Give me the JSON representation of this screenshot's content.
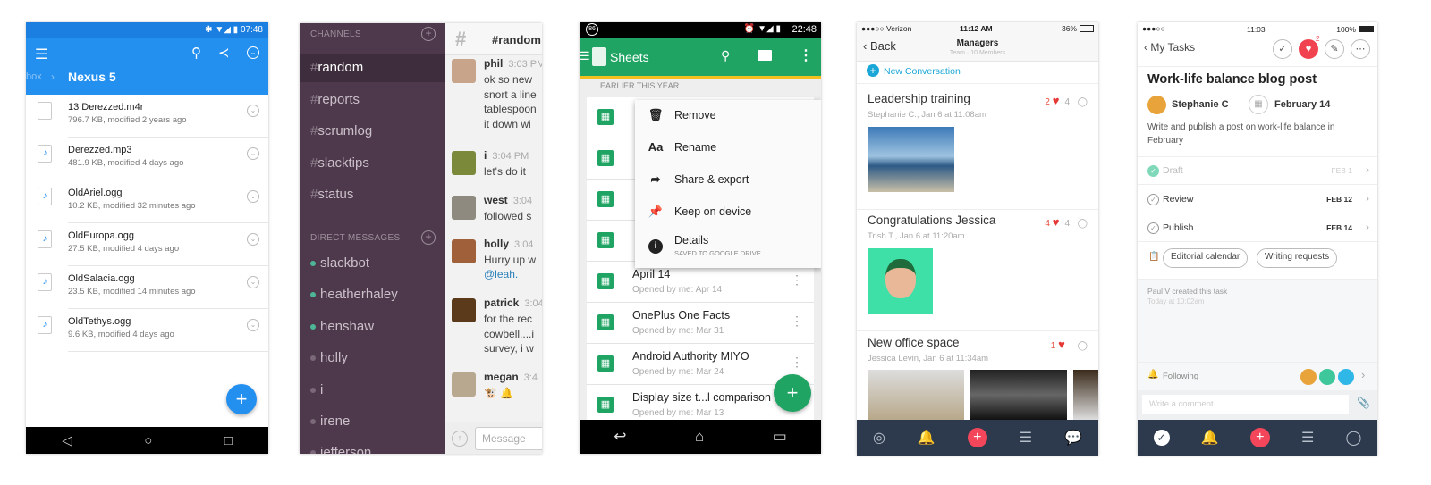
{
  "dropbox": {
    "status_time": "07:48",
    "breadcrumb_parent": "box",
    "breadcrumb_current": "Nexus 5",
    "accent": "#2390f0",
    "files": [
      {
        "name": "13 Derezzed.m4r",
        "meta": "796.7 KB, modified 2 years ago",
        "icon": "file-icon"
      },
      {
        "name": "Derezzed.mp3",
        "meta": "481.9 KB, modified 4 days ago",
        "icon": "music-file-icon"
      },
      {
        "name": "OldAriel.ogg",
        "meta": "10.2 KB, modified 32 minutes ago",
        "icon": "music-file-icon"
      },
      {
        "name": "OldEuropa.ogg",
        "meta": "27.5 KB, modified 4 days ago",
        "icon": "music-file-icon"
      },
      {
        "name": "OldSalacia.ogg",
        "meta": "23.5 KB, modified 14 minutes ago",
        "icon": "music-file-icon"
      },
      {
        "name": "OldTethys.ogg",
        "meta": "9.6 KB, modified 4 days ago",
        "icon": "music-file-icon"
      }
    ]
  },
  "slack": {
    "channels_header": "CHANNELS",
    "dm_header": "DIRECT MESSAGES",
    "hash": "#",
    "channels": [
      "random",
      "reports",
      "scrumlog",
      "slacktips",
      "status"
    ],
    "dms": [
      {
        "name": "slackbot",
        "online": true
      },
      {
        "name": "heatherhaley",
        "online": true
      },
      {
        "name": "henshaw",
        "online": true
      },
      {
        "name": "holly",
        "online": false
      },
      {
        "name": "i",
        "online": false
      },
      {
        "name": "irene",
        "online": false
      },
      {
        "name": "jefferson",
        "online": false
      }
    ],
    "channel_title": "#random",
    "message_placeholder": "Message",
    "messages": [
      {
        "user": "phil",
        "time": "3:03 PM",
        "text": "ok so new\nsnort a line\ntablespoon\nit down wi"
      },
      {
        "user": "i",
        "time": "3:04 PM",
        "text": "let's do it"
      },
      {
        "user": "west",
        "time": "3:04",
        "text": "followed s"
      },
      {
        "user": "holly",
        "time": "3:04",
        "text": "Hurry up w",
        "mention": "@leah."
      },
      {
        "user": "patrick",
        "time": "3:04",
        "text": "for the rec\ncowbell....i\nsurvey, i w"
      },
      {
        "user": "megan",
        "time": "3:4",
        "text": "🐮 🔔"
      }
    ]
  },
  "sheets": {
    "status_time": "22:48",
    "status_badge": "86",
    "app_title": "Sheets",
    "section": "EARLIER THIS YEAR",
    "accent": "#1fa463",
    "menu": [
      {
        "label": "Remove",
        "icon": "trash-icon"
      },
      {
        "label": "Rename",
        "icon": "text-icon"
      },
      {
        "label": "Share & export",
        "icon": "share-icon"
      },
      {
        "label": "Keep on device",
        "icon": "pin-icon"
      },
      {
        "label": "Details",
        "sub": "SAVED TO GOOGLE DRIVE",
        "icon": "info-icon"
      }
    ],
    "files": [
      {
        "name": "April 14",
        "meta": "Opened by me: Apr 14"
      },
      {
        "name": "OnePlus One Facts",
        "meta": "Opened by me: Mar 31"
      },
      {
        "name": "Android Authority MIYO",
        "meta": "Opened by me: Mar 24"
      },
      {
        "name": "Display size t...l comparison",
        "meta": "Opened by me: Mar 13"
      }
    ]
  },
  "team": {
    "carrier": "●●●○○ Verizon",
    "time": "11:12 AM",
    "battery": "36%",
    "back": "Back",
    "title": "Managers",
    "subtitle": "Team · 10 Members",
    "new_conversation": "New Conversation",
    "posts": [
      {
        "title": "Leadership training",
        "by": "Stephanie C., Jan 6 at 11:08am",
        "likes": "2",
        "comments": "4"
      },
      {
        "title": "Congratulations Jessica",
        "by": "Trish T., Jan 6 at 11:20am",
        "likes": "4",
        "comments": "4"
      },
      {
        "title": "New office space",
        "by": "Jessica Levin, Jan 6 at 11:34am",
        "likes": "1",
        "comments": ""
      }
    ]
  },
  "asana": {
    "carrier": "●●●○○",
    "time": "11:03",
    "battery": "100%",
    "back": "My Tasks",
    "like_count": "2",
    "task_title": "Work-life balance blog post",
    "assignee": "Stephanie C",
    "due": "February 14",
    "description": "Write and publish a post on work-life balance in February",
    "subtasks": [
      {
        "name": "Draft",
        "date": "FEB 1",
        "done": true
      },
      {
        "name": "Review",
        "date": "FEB 12",
        "done": false
      },
      {
        "name": "Publish",
        "date": "FEB 14",
        "done": false
      }
    ],
    "tags": [
      "Editorial calendar",
      "Writing requests"
    ],
    "activity": "Paul V created this task",
    "activity_time": "Today at 10:02am",
    "following": "Following",
    "comment_placeholder": "Write a comment ..."
  }
}
